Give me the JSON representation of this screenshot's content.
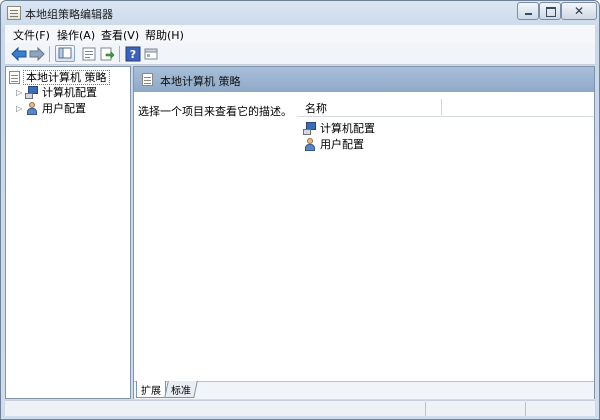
{
  "window": {
    "title": "本地组策略编辑器",
    "close_glyph": "✕"
  },
  "menubar": {
    "items": [
      {
        "label": "文件(F)"
      },
      {
        "label": "操作(A)"
      },
      {
        "label": "查看(V)"
      },
      {
        "label": "帮助(H)"
      }
    ]
  },
  "toolbar": {
    "buttons": [
      "back-icon",
      "forward-icon",
      "show-hide-console-tree-icon",
      "properties-icon",
      "export-list-icon",
      "help-icon",
      "view-icon"
    ],
    "back_glyph": "⇦",
    "forward_glyph": "⇨",
    "help_glyph": "?"
  },
  "tree": {
    "root": {
      "label": "本地计算机 策略"
    },
    "children": [
      {
        "label": "计算机配置",
        "expander": "▷"
      },
      {
        "label": "用户配置",
        "expander": "▷"
      }
    ]
  },
  "content": {
    "header_title": "本地计算机 策略",
    "description": "选择一个项目来查看它的描述。",
    "column_name": "名称",
    "rows": [
      {
        "label": "计算机配置"
      },
      {
        "label": "用户配置"
      }
    ]
  },
  "tabs": [
    {
      "label": "扩展"
    },
    {
      "label": "标准"
    }
  ],
  "colors": {
    "header_bg": "#8ea9c9",
    "window_frame": "#c9d8ea"
  }
}
